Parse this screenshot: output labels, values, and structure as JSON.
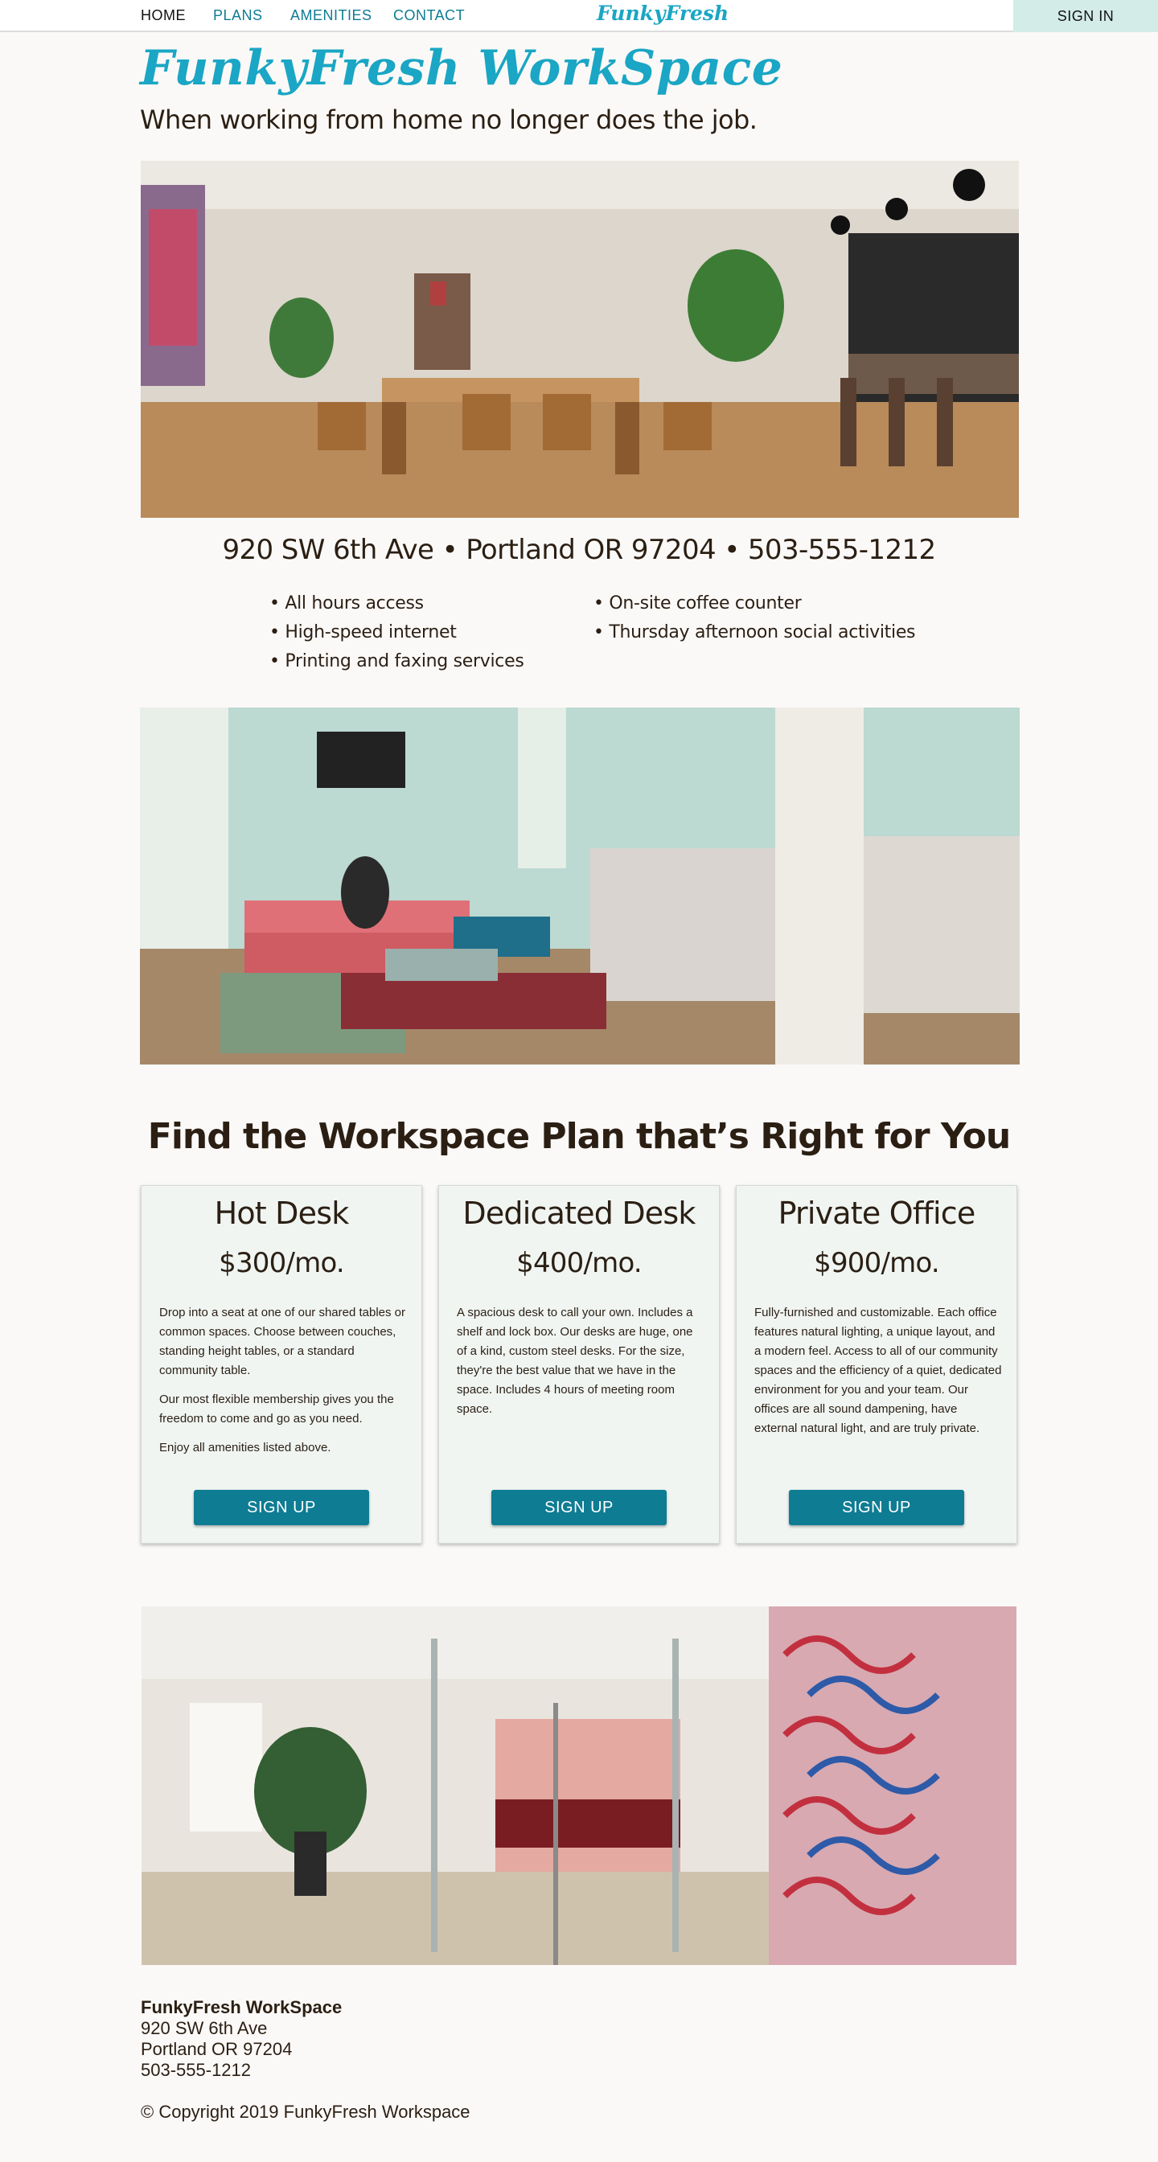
{
  "nav": {
    "links": [
      "HOME",
      "PLANS",
      "AMENITIES",
      "CONTACT"
    ],
    "logo": "FunkyFresh",
    "signin": "SIGN IN",
    "active_color": "#111111",
    "link_color": "#0e7c93",
    "signin_bg": "#d4ece7"
  },
  "hero": {
    "title": "FunkyFresh WorkSpace",
    "subtitle": "When working from home no longer does the job.",
    "title_color": "#1aa6c4"
  },
  "contact_line": "920 SW 6th Ave • Portland OR 97204 • 503-555-1212",
  "amenities": [
    "• All hours access",
    "• High-speed internet",
    "• Printing and faxing services",
    "• On-site coffee counter",
    "• Thursday afternoon social activities"
  ],
  "plans": {
    "heading": "Find the Workspace Plan that’s Right for You",
    "cards": [
      {
        "name": "Hot Desk",
        "price": "$300/mo.",
        "paragraphs": [
          "Drop into a seat at one of our shared tables or common spaces. Choose between couches, standing height tables, or a standard community table.",
          "Our most flexible membership gives you the freedom to come and go as you need.",
          "Enjoy all amenities listed above."
        ],
        "button": "SIGN UP"
      },
      {
        "name": "Dedicated Desk",
        "price": "$400/mo.",
        "paragraphs": [
          "A spacious desk to call your own. Includes a shelf and lock box. Our desks are huge, one of a kind, custom steel desks. For the size, they're the best value that we have in the space. Includes 4 hours of meeting room space."
        ],
        "button": "SIGN UP"
      },
      {
        "name": "Private Office",
        "price": "$900/mo.",
        "paragraphs": [
          "Fully-furnished and customizable. Each office features natural lighting, a unique layout, and a modern feel. Access to all of our community spaces and the efficiency of a quiet, dedicated environment for you and your team. Our offices are all sound dampening, have external natural light, and are truly private."
        ],
        "button": "SIGN UP"
      }
    ],
    "button_color": "#0e7c93",
    "card_bg": "#f0f5f2"
  },
  "footer": {
    "name": "FunkyFresh WorkSpace",
    "address1": "920 SW 6th Ave",
    "address2": "Portland OR 97204",
    "phone": "503-555-1212",
    "copyright": "© Copyright 2019 FunkyFresh Workspace"
  },
  "images": [
    "cafe-workspace-photo",
    "lounge-photo",
    "entrance-photo"
  ]
}
